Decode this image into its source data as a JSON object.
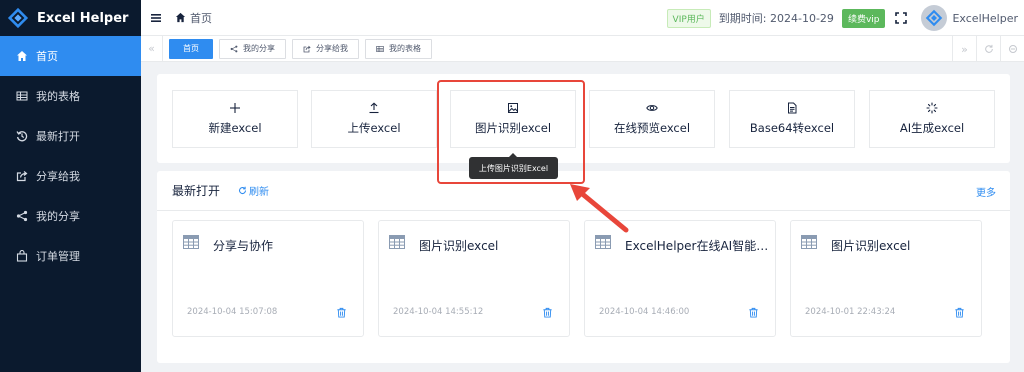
{
  "app": {
    "name": "Excel Helper"
  },
  "sidebar": {
    "items": [
      {
        "label": "首页",
        "icon": "home-icon",
        "active": true
      },
      {
        "label": "我的表格",
        "icon": "table-icon",
        "active": false
      },
      {
        "label": "最新打开",
        "icon": "history-icon",
        "active": false
      },
      {
        "label": "分享给我",
        "icon": "share-in-icon",
        "active": false
      },
      {
        "label": "我的分享",
        "icon": "share-icon",
        "active": false
      },
      {
        "label": "订单管理",
        "icon": "bag-icon",
        "active": false
      }
    ]
  },
  "header": {
    "breadcrumb": "首页",
    "vip_label": "VIP用户",
    "expiry_text": "到期时间: 2024-10-29",
    "renew_label": "续费vip",
    "username": "ExcelHelper"
  },
  "tabs": [
    {
      "label": "首页",
      "active": true,
      "icon": ""
    },
    {
      "label": "我的分享",
      "active": false,
      "icon": "share-icon"
    },
    {
      "label": "分享给我",
      "active": false,
      "icon": "share-in-icon"
    },
    {
      "label": "我的表格",
      "active": false,
      "icon": "table-icon"
    }
  ],
  "tools": [
    {
      "label": "新建excel",
      "icon": "plus-icon"
    },
    {
      "label": "上传excel",
      "icon": "upload-icon"
    },
    {
      "label": "图片识别excel",
      "icon": "image-icon"
    },
    {
      "label": "在线预览excel",
      "icon": "eye-icon"
    },
    {
      "label": "Base64转excel",
      "icon": "document-icon"
    },
    {
      "label": "AI生成excel",
      "icon": "spinner-icon"
    }
  ],
  "tooltip": "上传图片识别Excel",
  "recent": {
    "title": "最新打开",
    "refresh_label": "刷新",
    "more_label": "更多",
    "files": [
      {
        "name": "分享与协作",
        "date": "2024-10-04 15:07:08"
      },
      {
        "name": "图片识别excel",
        "date": "2024-10-04 14:55:12"
      },
      {
        "name": "ExcelHelper在线AI智能生成",
        "date": "2024-10-04 14:46:00"
      },
      {
        "name": "图片识别excel",
        "date": "2024-10-01 22:43:24"
      }
    ]
  },
  "colors": {
    "sidebar_bg": "#0b1a2e",
    "accent": "#2f8cf0",
    "vip_green": "#5cb85c",
    "highlight_red": "#e8463a"
  }
}
